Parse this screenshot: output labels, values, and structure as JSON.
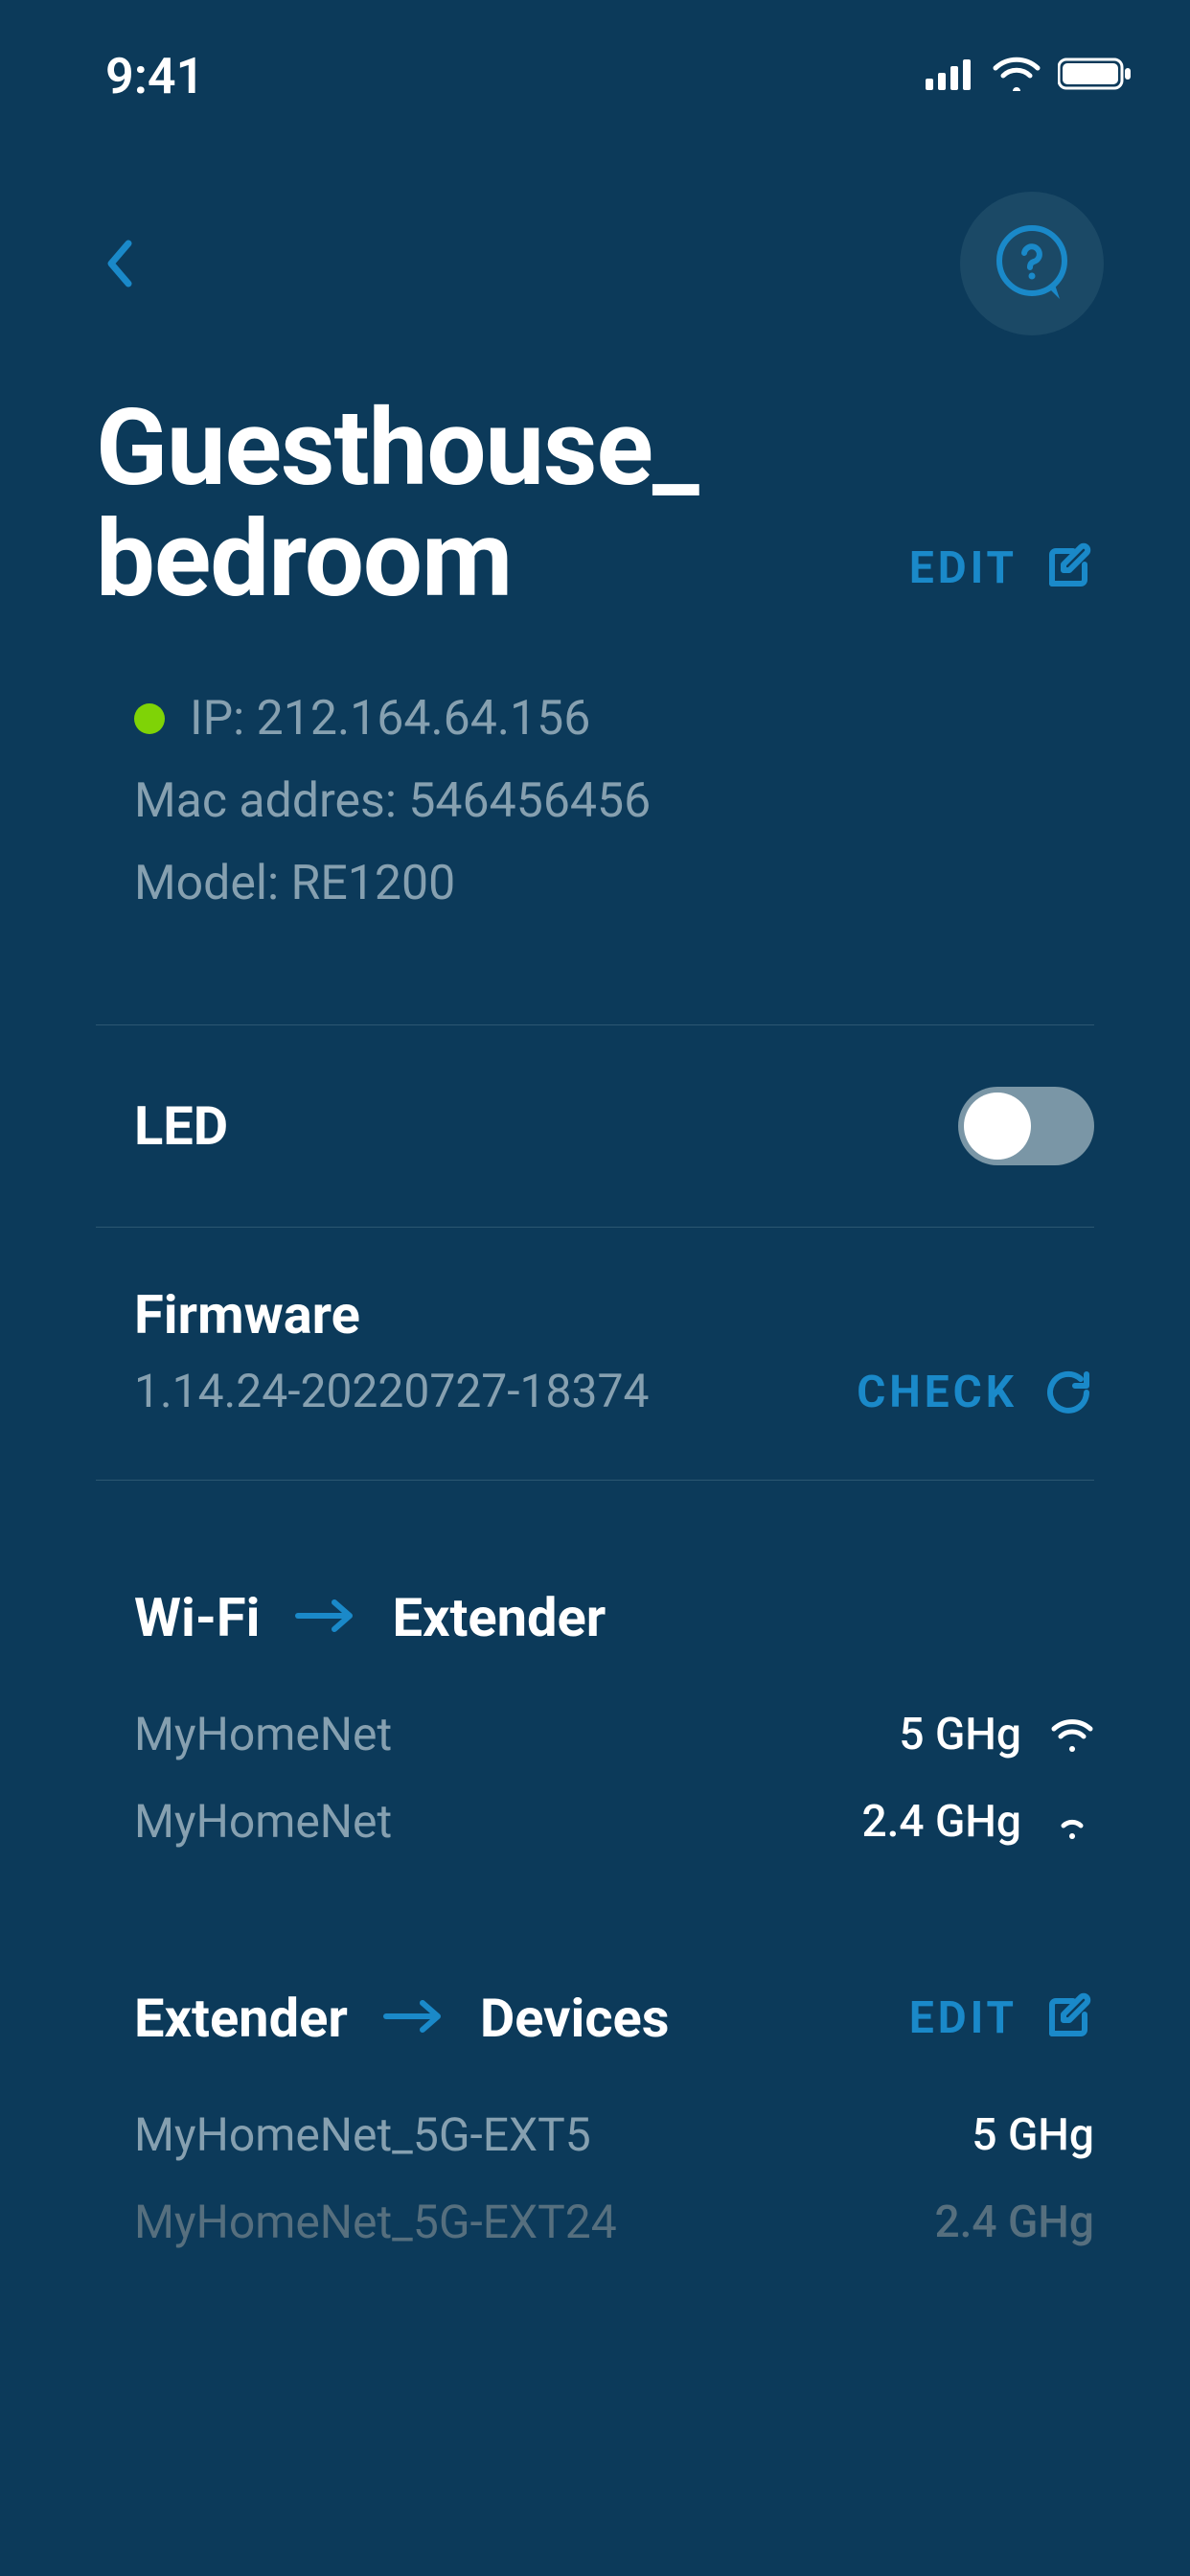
{
  "statusBar": {
    "time": "9:41"
  },
  "header": {
    "title": "Guesthouse_\nbedroom",
    "editLabel": "EDIT"
  },
  "deviceInfo": {
    "ipLabel": "IP: 212.164.64.156",
    "macLabel": "Mac addres: 546456456",
    "modelLabel": "Model: RE1200",
    "statusColor": "#7fd306"
  },
  "led": {
    "label": "LED",
    "on": false
  },
  "firmware": {
    "title": "Firmware",
    "version": "1.14.24-20220727-18374",
    "checkLabel": "CHECK"
  },
  "sections": {
    "wifiToExtender": {
      "left": "Wi-Fi",
      "right": "Extender",
      "networks": [
        {
          "ssid": "MyHomeNet",
          "band": "5 GHg",
          "strength": "full"
        },
        {
          "ssid": "MyHomeNet",
          "band": "2.4 GHg",
          "strength": "weak"
        }
      ]
    },
    "extenderToDevices": {
      "left": "Extender",
      "right": "Devices",
      "editLabel": "EDIT",
      "networks": [
        {
          "ssid": "MyHomeNet_5G-EXT5",
          "band": "5 GHg"
        },
        {
          "ssid": "MyHomeNet_5G-EXT24",
          "band": "2.4 GHg"
        }
      ]
    }
  }
}
